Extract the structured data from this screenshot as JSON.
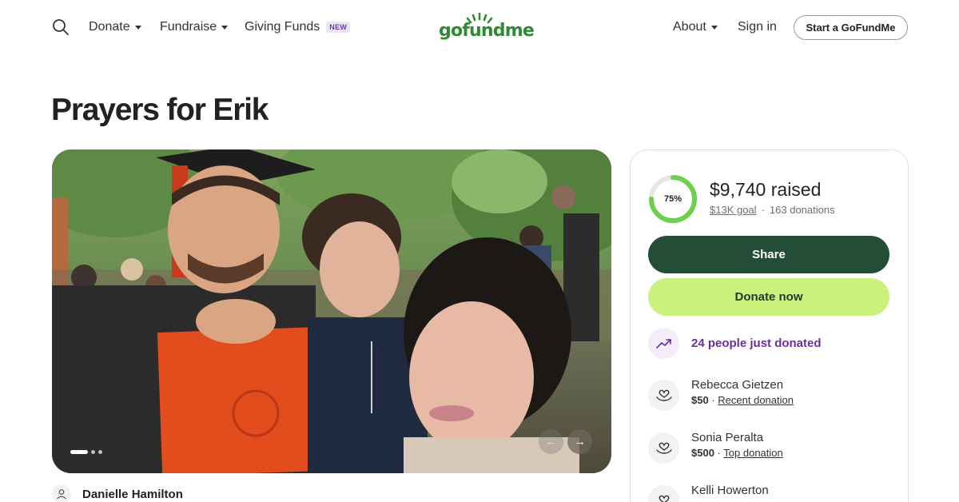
{
  "header": {
    "nav_left": [
      {
        "label": "Donate",
        "has_caret": true
      },
      {
        "label": "Fundraise",
        "has_caret": true
      },
      {
        "label": "Giving Funds",
        "badge": "NEW"
      }
    ],
    "logo_text": "gofundme",
    "about_label": "About",
    "signin_label": "Sign in",
    "start_label": "Start a GoFundMe"
  },
  "campaign": {
    "title": "Prayers for Erik",
    "organizer": "Danielle Hamilton",
    "image_count": 3,
    "image_index": 1
  },
  "donation_card": {
    "percent": 75,
    "percent_label": "75%",
    "raised": "$9,740 raised",
    "goal": "$13K goal",
    "separator": "·",
    "donation_count": "163 donations",
    "share_label": "Share",
    "donate_label": "Donate now",
    "trend_text": "24 people just donated",
    "donations": [
      {
        "name": "Rebecca Gietzen",
        "amount": "$50",
        "tag": "Recent donation"
      },
      {
        "name": "Sonia Peralta",
        "amount": "$500",
        "tag": "Top donation"
      },
      {
        "name": "Kelli Howerton",
        "amount": "",
        "tag": ""
      }
    ]
  },
  "colors": {
    "brand_green": "#2e8b32",
    "share_bg": "#234d36",
    "donate_bg": "#c9f27d",
    "progress": "#6bd04a",
    "trend_purple": "#6b2ea0"
  },
  "icons": {
    "search": "search-icon",
    "trend": "trending-up-icon",
    "donation": "heart-hand-icon",
    "user": "user-icon"
  }
}
